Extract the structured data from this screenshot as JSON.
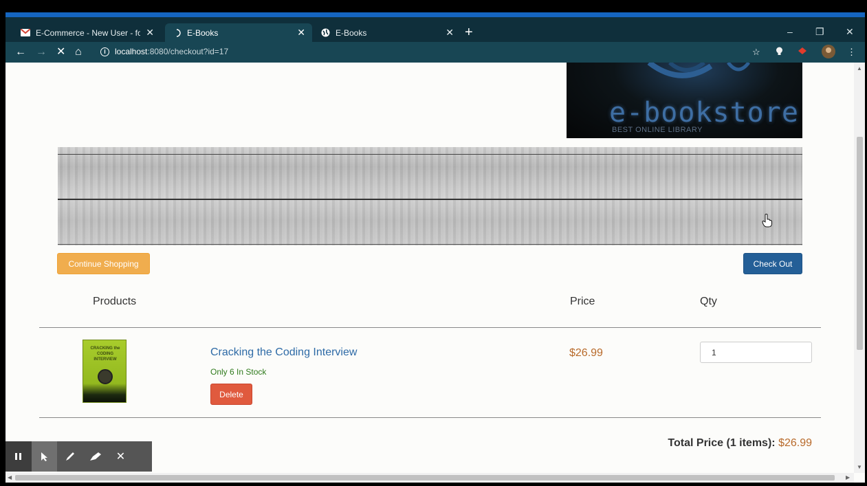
{
  "browser": {
    "tabs": [
      {
        "title": "E-Commerce - New User - foysal",
        "close": "✕",
        "favicon": "gmail-icon",
        "active": false
      },
      {
        "title": "E-Books",
        "close": "✕",
        "favicon": "loading-icon",
        "active": true
      },
      {
        "title": "E-Books",
        "close": "✕",
        "favicon": "globe-icon",
        "active": false
      }
    ],
    "new_tab": "+",
    "window_controls": [
      "–",
      "❐",
      "✕"
    ],
    "url_host": "localhost",
    "url_path": ":8080/checkout?id=17"
  },
  "page": {
    "logo": {
      "text": "e-bookstore",
      "tagline": "BEST ONLINE LIBRARY"
    },
    "buttons": {
      "continue": "Continue Shopping",
      "checkout": "Check Out"
    },
    "table_headers": {
      "products": "Products",
      "price": "Price",
      "qty": "Qty"
    },
    "items": [
      {
        "cover_title": "CRACKING the CODING INTERVIEW",
        "name": "Cracking the Coding Interview",
        "stock": "Only 6 In Stock",
        "delete_label": "Delete",
        "price": "$26.99",
        "qty": "1"
      }
    ],
    "total_label": "Total Price (1 items): ",
    "total_amount": "$26.99"
  },
  "annotation_toolbar": {
    "tools": [
      "pause-icon",
      "pointer-icon",
      "pen-icon",
      "highlighter-icon",
      "close-icon"
    ]
  },
  "colors": {
    "accent_blue": "#245f97",
    "warning_orange": "#f0ad4e",
    "danger_red": "#e05a3e",
    "price_brown": "#b86a2a"
  }
}
